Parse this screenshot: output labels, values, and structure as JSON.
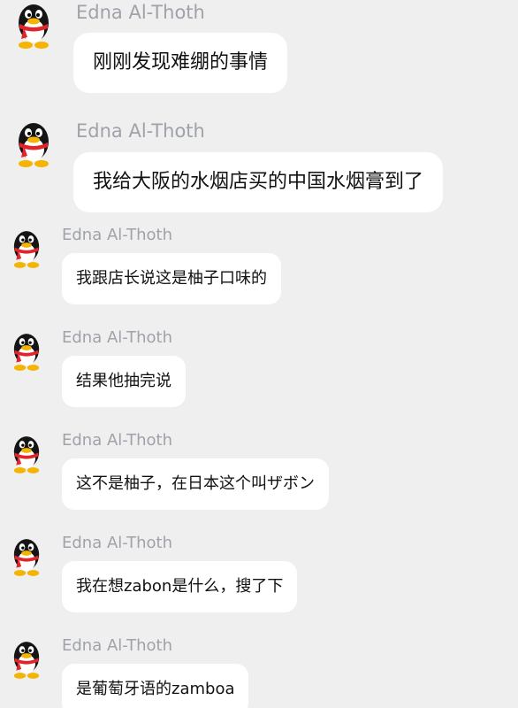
{
  "messages": [
    {
      "sender": "Edna Al-Thoth",
      "text": "刚刚发现难绷的事情"
    },
    {
      "sender": "Edna Al-Thoth",
      "text": "我给大阪的水烟店买的中国水烟膏到了"
    },
    {
      "sender": "Edna Al-Thoth",
      "text": "我跟店长说这是柚子口味的"
    },
    {
      "sender": "Edna Al-Thoth",
      "text": "结果他抽完说"
    },
    {
      "sender": "Edna Al-Thoth",
      "text": "这不是柚子，在日本这个叫ザボン"
    },
    {
      "sender": "Edna Al-Thoth",
      "text": "我在想zabon是什么，搜了下"
    },
    {
      "sender": "Edna Al-Thoth",
      "text": "是葡萄牙语的zamboa"
    }
  ],
  "avatar_icon": "qq-penguin-icon",
  "colors": {
    "background": "#efeff0",
    "bubble": "#ffffff",
    "sender": "#9fa2a8",
    "text": "#111111",
    "scarf": "#e0242a"
  }
}
